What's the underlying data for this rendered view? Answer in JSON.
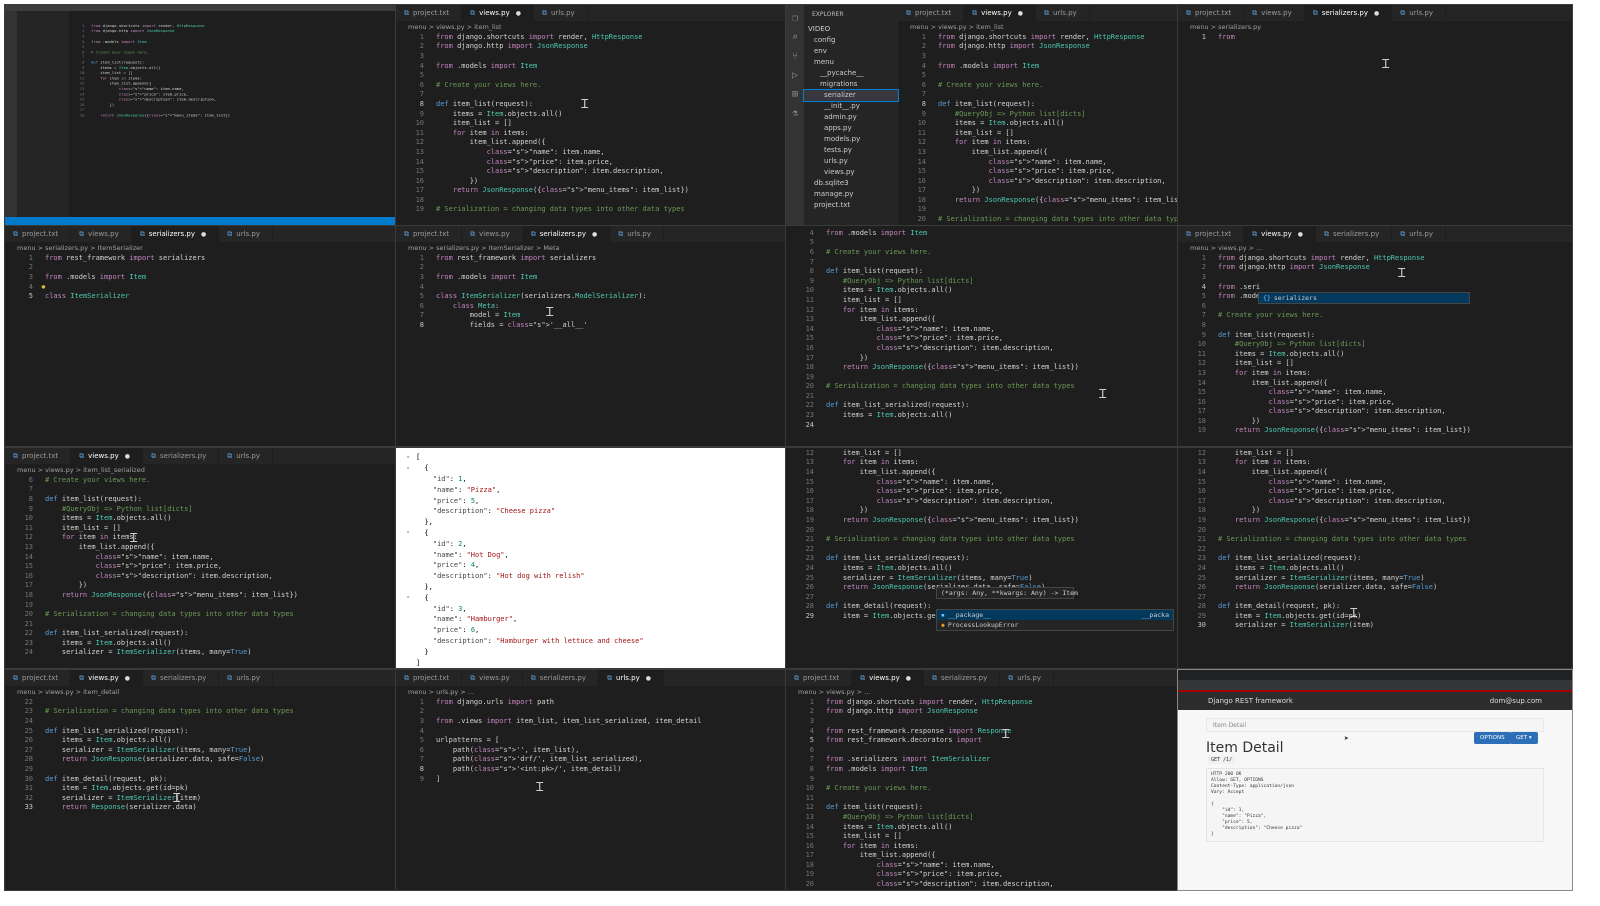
{
  "p1": {
    "caption": "VS Code full window — views.py",
    "lines": [
      "from django.shortcuts import render, HttpResponse",
      "from django.http import JsonResponse",
      "",
      "from .models import Item",
      "",
      "# Create your views here.",
      "",
      "def item_list(request):",
      "    items = Item.objects.all()",
      "    item_list = []",
      "    for item in items:",
      "        item_list.append({",
      "            \"name\": item.name,",
      "            \"price\": item.price,",
      "            \"description\": item.description,",
      "        })",
      "",
      "    return JsonResponse({\"menu_items\": item_list})"
    ]
  },
  "p2": {
    "tabs": [
      "project.txt",
      "views.py",
      "urls.py"
    ],
    "active_tab": 1,
    "crumb": "menu > views.py > item_list",
    "start": 1,
    "current": 8,
    "lines": [
      "from django.shortcuts import render, HttpResponse",
      "from django.http import JsonResponse",
      "",
      "from .models import Item",
      "",
      "# Create your views here.",
      "",
      "def item_list(request):",
      "    items = Item.objects.all()",
      "    item_list = []",
      "    for item in items:",
      "        item_list.append({",
      "            \"name\": item.name,",
      "            \"price\": item.price,",
      "            \"description\": item.description,",
      "        })",
      "    return JsonResponse({\"menu_items\": item_list})",
      "",
      "# Serialization = changing data types into other data types"
    ]
  },
  "p3": {
    "explorer_title": "EXPLORER",
    "explorer_items": [
      "VIDEO",
      "config",
      "env",
      "menu",
      "__pycache__",
      "migrations",
      "serializer",
      "__init__.py",
      "admin.py",
      "apps.py",
      "models.py",
      "tests.py",
      "urls.py",
      "views.py",
      "db.sqlite3",
      "manage.py",
      "project.txt"
    ],
    "tabs": [
      "project.txt",
      "views.py",
      "urls.py"
    ],
    "active_tab": 1,
    "crumb": "menu > views.py > item_list",
    "start": 1,
    "current": 8,
    "lines": [
      "from django.shortcuts import render, HttpResponse",
      "from django.http import JsonResponse",
      "",
      "from .models import Item",
      "",
      "# Create your views here.",
      "",
      "def item_list(request):",
      "    #QueryObj => Python list[dicts]",
      "    items = Item.objects.all()",
      "    item_list = []",
      "    for item in items:",
      "        item_list.append({",
      "            \"name\": item.name,",
      "            \"price\": item.price,",
      "            \"description\": item.description,",
      "        })",
      "    return JsonResponse({\"menu_items\": item_list})",
      "",
      "# Serialization = changing data types into other data types"
    ]
  },
  "p4": {
    "tabs": [
      "project.txt",
      "views.py",
      "serializers.py",
      "urls.py"
    ],
    "active_tab": 2,
    "crumb": "menu > serializers.py",
    "start": 1,
    "current": 1,
    "lines": [
      "from "
    ]
  },
  "p5": {
    "tabs": [
      "project.txt",
      "views.py",
      "serializers.py",
      "urls.py"
    ],
    "active_tab": 2,
    "crumb": "menu > serializers.py > ItemSerializer",
    "start": 1,
    "current": 5,
    "lines": [
      "from rest_framework import serializers",
      "",
      "from .models import Item",
      "",
      "class ItemSerializer"
    ]
  },
  "p6": {
    "tabs": [
      "project.txt",
      "views.py",
      "serializers.py",
      "urls.py"
    ],
    "active_tab": 2,
    "crumb": "menu > serializers.py > ItemSerializer > Meta",
    "start": 1,
    "current": 8,
    "lines": [
      "from rest_framework import serializers",
      "",
      "from .models import Item",
      "",
      "class ItemSerializer(serializers.ModelSerializer):",
      "    class Meta:",
      "        model = Item",
      "        fields = '__all__'"
    ]
  },
  "p7": {
    "start": 4,
    "current": 24,
    "lines": [
      "from .models import Item",
      "",
      "# Create your views here.",
      "",
      "def item_list(request):",
      "    #QueryObj => Python list[dicts]",
      "    items = Item.objects.all()",
      "    item_list = []",
      "    for item in items:",
      "        item_list.append({",
      "            \"name\": item.name,",
      "            \"price\": item.price,",
      "            \"description\": item.description,",
      "        })",
      "    return JsonResponse({\"menu_items\": item_list})",
      "",
      "# Serialization = changing data types into other data types",
      "",
      "def item_list_serialized(request):",
      "    items = Item.objects.all()",
      ""
    ]
  },
  "p8": {
    "tabs": [
      "project.txt",
      "views.py",
      "serializers.py",
      "urls.py"
    ],
    "active_tab": 1,
    "crumb": "menu > views.py > ...",
    "start": 1,
    "current": 4,
    "lines": [
      "from django.shortcuts import render, HttpResponse",
      "from django.http import JsonResponse",
      "",
      "from .seri",
      "from .mode",
      "",
      "# Create your views here.",
      "",
      "def item_list(request):",
      "    #QueryObj => Python list[dicts]",
      "    items = Item.objects.all()",
      "    item_list = []",
      "    for item in items:",
      "        item_list.append({",
      "            \"name\": item.name,",
      "            \"price\": item.price,",
      "            \"description\": item.description,",
      "        })",
      "    return JsonResponse({\"menu_items\": item_list})"
    ],
    "suggestion": "serializers"
  },
  "p9": {
    "tabs": [
      "project.txt",
      "views.py",
      "serializers.py",
      "urls.py"
    ],
    "active_tab": 1,
    "crumb": "menu > views.py > item_list_serialized",
    "start": 6,
    "lines": [
      "# Create your views here.",
      "",
      "def item_list(request):",
      "    #QueryObj => Python list[dicts]",
      "    items = Item.objects.all()",
      "    item_list = []",
      "    for item in items:",
      "        item_list.append({",
      "            \"name\": item.name,",
      "            \"price\": item.price,",
      "            \"description\": item.description,",
      "        })",
      "    return JsonResponse({\"menu_items\": item_list})",
      "",
      "# Serialization = changing data types into other data types",
      "",
      "def item_list_serialized(request):",
      "    items = Item.objects.all()",
      "    serializer = ItemSerializer(items, many=True)"
    ]
  },
  "p10": {
    "lines": [
      "[",
      "  {",
      "    \"id\": 1,",
      "    \"name\": \"Pizza\",",
      "    \"price\": 5,",
      "    \"description\": \"Cheese pizza\"",
      "  },",
      "  {",
      "    \"id\": 2,",
      "    \"name\": \"Hot Dog\",",
      "    \"price\": 4,",
      "    \"description\": \"Hot dog with relish\"",
      "  },",
      "  {",
      "    \"id\": 3,",
      "    \"name\": \"Hamburger\",",
      "    \"price\": 6,",
      "    \"description\": \"Hamburger with lettuce and cheese\"",
      "  }",
      "]"
    ]
  },
  "p11": {
    "start": 12,
    "current": 29,
    "lines": [
      "    item_list = []",
      "    for item in items:",
      "        item_list.append({",
      "            \"name\": item.name,",
      "            \"price\": item.price,",
      "            \"description\": item.description,",
      "        })",
      "    return JsonResponse({\"menu_items\": item_list})",
      "",
      "# Serialization = changing data types into other data types",
      "",
      "def item_list_serialized(request):",
      "    items = Item.objects.all()",
      "    serializer = ItemSerializer(items, many=True)",
      "    return JsonResponse(serializer.data, safe=False)",
      "",
      "def item_detail(request):",
      "    item = Item.objects.get(id=pk)"
    ],
    "signature": "(*args: Any, **kwargs: Any) -> Item",
    "suggestions": [
      "__package__",
      "ProcessLookupError"
    ],
    "suggestion_right": "__packa"
  },
  "p12": {
    "start": 12,
    "current": 30,
    "lines": [
      "    item_list = []",
      "    for item in items:",
      "        item_list.append({",
      "            \"name\": item.name,",
      "            \"price\": item.price,",
      "            \"description\": item.description,",
      "        })",
      "    return JsonResponse({\"menu_items\": item_list})",
      "",
      "# Serialization = changing data types into other data types",
      "",
      "def item_list_serialized(request):",
      "    items = Item.objects.all()",
      "    serializer = ItemSerializer(items, many=True)",
      "    return JsonResponse(serializer.data, safe=False)",
      "",
      "def item_detail(request, pk):",
      "    item = Item.objects.get(id=pk)",
      "    serializer = ItemSerializer(item)"
    ]
  },
  "p13": {
    "tabs": [
      "project.txt",
      "views.py",
      "serializers.py",
      "urls.py"
    ],
    "active_tab": 1,
    "crumb": "menu > views.py > item_detail",
    "start": 22,
    "current": 33,
    "lines": [
      "",
      "# Serialization = changing data types into other data types",
      "",
      "def item_list_serialized(request):",
      "    items = Item.objects.all()",
      "    serializer = ItemSerializer(items, many=True)",
      "    return JsonResponse(serializer.data, safe=False)",
      "",
      "def item_detail(request, pk):",
      "    item = Item.objects.get(id=pk)",
      "    serializer = ItemSerializer(item)",
      "    return Response(serializer.data)"
    ]
  },
  "p14": {
    "tabs": [
      "project.txt",
      "views.py",
      "serializers.py",
      "urls.py"
    ],
    "active_tab": 3,
    "crumb": "menu > urls.py > ...",
    "start": 1,
    "current": 8,
    "lines": [
      "from django.urls import path",
      "",
      "from .views import item_list, item_list_serialized, item_detail",
      "",
      "urlpatterns = [",
      "    path('', item_list),",
      "    path('drf/', item_list_serialized),",
      "    path('<int:pk>/', item_detail)",
      "]"
    ]
  },
  "p15": {
    "tabs": [
      "project.txt",
      "views.py",
      "serializers.py",
      "urls.py"
    ],
    "active_tab": 1,
    "crumb": "menu > views.py > ...",
    "start": 1,
    "current": 5,
    "lines": [
      "from django.shortcuts import render, HttpResponse",
      "from django.http import JsonResponse",
      "",
      "from rest_framework.response import Response",
      "from rest_framework.decorators import ",
      "",
      "from .serializers import ItemSerializer",
      "from .models import Item",
      "",
      "# Create your views here.",
      "",
      "def item_list(request):",
      "    #QueryObj => Python list[dicts]",
      "    items = Item.objects.all()",
      "    item_list = []",
      "    for item in items:",
      "        item_list.append({",
      "            \"name\": item.name,",
      "            \"price\": item.price,",
      "            \"description\": item.description,",
      "        })"
    ]
  },
  "p16": {
    "brand": "Django REST framework",
    "user": "dom@sup.com",
    "crumb": "Item Detail",
    "title": "Item Detail",
    "options_label": "OPTIONS",
    "get_label": "GET",
    "request_line": "GET /1/",
    "response": [
      "HTTP 200 OK",
      "Allow: GET, OPTIONS",
      "Content-Type: application/json",
      "Vary: Accept",
      "",
      "{",
      "    \"id\": 1,",
      "    \"name\": \"Pizza\",",
      "    \"price\": 5,",
      "    \"description\": \"Cheese pizza\"",
      "}"
    ]
  }
}
